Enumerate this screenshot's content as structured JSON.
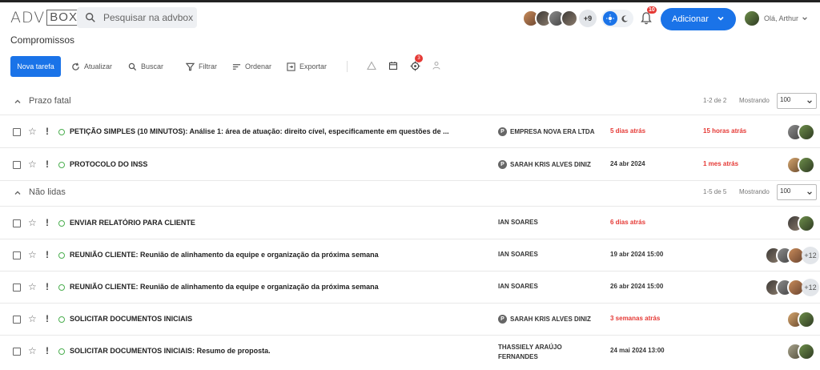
{
  "header": {
    "logo_a": "ADV",
    "logo_b": "BOX",
    "search_placeholder": "Pesquisar na advbox",
    "team_more": "+9",
    "notification_count": "10",
    "add_label": "Adicionar",
    "user_greeting": "Olá, Arthur"
  },
  "page_title": "Compromissos",
  "toolbar": {
    "new_task": "Nova tarefa",
    "refresh": "Atualizar",
    "search": "Buscar",
    "filter": "Filtrar",
    "sort": "Ordenar",
    "export": "Exportar",
    "target_badge": "3"
  },
  "sections": [
    {
      "title": "Prazo fatal",
      "range": "1-2 de 2",
      "showing_label": "Mostrando",
      "per_page": "100",
      "rows": [
        {
          "task": "PETIÇÃO SIMPLES (10 MINUTOS): Análise 1: área de atuação: direito cível, especificamente em questões de ...",
          "person": "EMPRESA NOVA ERA LTDA",
          "person_badge": "P",
          "date": "5 dias atrás",
          "due": "15 horas atrás"
        },
        {
          "task": "PROTOCOLO DO INSS",
          "person": "SARAH KRIS ALVES DINIZ",
          "person_badge": "P",
          "date": "24 abr 2024",
          "due": "1 mes atrás"
        }
      ]
    },
    {
      "title": "Não lidas",
      "range": "1-5 de 5",
      "showing_label": "Mostrando",
      "per_page": "100",
      "rows": [
        {
          "task": "ENVIAR RELATÓRIO PARA CLIENTE",
          "person": "IAN SOARES",
          "date": "6 dias atrás"
        },
        {
          "task": "REUNIÃO CLIENTE: Reunião de alinhamento da equipe e organização da próxima semana",
          "person": "IAN SOARES",
          "date": "19 abr 2024 15:00",
          "more": "+12"
        },
        {
          "task": "REUNIÃO CLIENTE: Reunião de alinhamento da equipe e organização da próxima semana",
          "person": "IAN SOARES",
          "date": "26 abr 2024 15:00",
          "more": "+12"
        },
        {
          "task": "SOLICITAR DOCUMENTOS INICIAIS",
          "person": "SARAH KRIS ALVES DINIZ",
          "person_badge": "P",
          "date": "3 semanas atrás"
        },
        {
          "task": "SOLICITAR DOCUMENTOS INICIAIS: Resumo de proposta.",
          "person_line1": "THASSIELY ARAÚJO",
          "person_line2": "FERNANDES",
          "date": "24 mai 2024 13:00"
        }
      ]
    }
  ],
  "colors": {
    "primary": "#1a73e8",
    "overdue": "#e53935",
    "status_dot": "#4caf50"
  }
}
